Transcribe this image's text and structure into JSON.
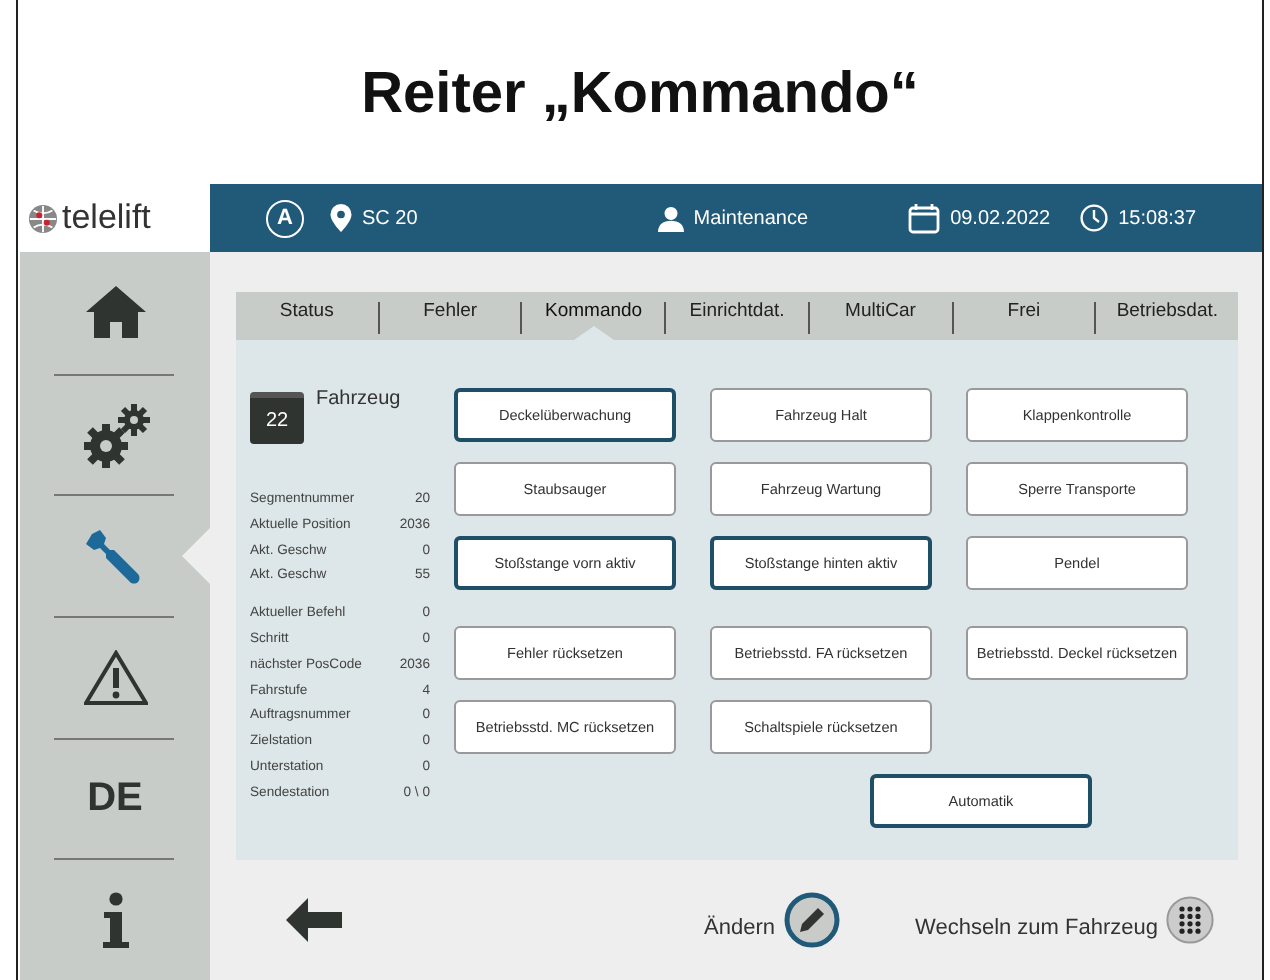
{
  "title": "Reiter „Kommando“",
  "header": {
    "logo": "telelift",
    "mode": "A",
    "station": "SC 20",
    "user": "Maintenance",
    "date": "09.02.2022",
    "time": "15:08:37"
  },
  "sidebar": {
    "items": [
      {
        "kind": "home",
        "selected": false
      },
      {
        "kind": "gears",
        "selected": false
      },
      {
        "kind": "wrench",
        "selected": true
      },
      {
        "kind": "warning",
        "selected": false
      },
      {
        "kind": "text",
        "label": "DE",
        "selected": false
      },
      {
        "kind": "info",
        "selected": false
      }
    ]
  },
  "tabs": [
    {
      "label": "Status",
      "selected": false
    },
    {
      "label": "Fehler",
      "selected": false
    },
    {
      "label": "Kommando",
      "selected": true
    },
    {
      "label": "Einrichtdat.",
      "selected": false
    },
    {
      "label": "MultiCar",
      "selected": false
    },
    {
      "label": "Frei",
      "selected": false
    },
    {
      "label": "Betriebsdat.",
      "selected": false
    }
  ],
  "vehicle": {
    "number": "22",
    "label": "Fahrzeug"
  },
  "stat_groups": [
    [
      {
        "name": "Segmentnummer",
        "value": "20"
      },
      {
        "name": "Aktuelle Position",
        "value": "2036"
      },
      {
        "name": "Akt. Geschw",
        "value": "0"
      },
      {
        "name": "Akt. Geschw",
        "value": "55"
      }
    ],
    [
      {
        "name": "Aktueller Befehl",
        "value": "0"
      },
      {
        "name": "Schritt",
        "value": "0"
      },
      {
        "name": "nächster PosCode",
        "value": "2036"
      },
      {
        "name": "Fahrstufe",
        "value": "4"
      },
      {
        "name": "Auftragsnummer",
        "value": "0"
      },
      {
        "name": "Zielstation",
        "value": "0"
      },
      {
        "name": "Unterstation",
        "value": "0"
      },
      {
        "name": "Sendestation",
        "value": "0 \\ 0"
      }
    ]
  ],
  "command_rows": [
    [
      {
        "label": "Deckelüberwachung",
        "active": true
      },
      {
        "label": "Fahrzeug Halt",
        "active": false
      },
      {
        "label": "Klappenkontrolle",
        "active": false
      }
    ],
    [
      {
        "label": "Staubsauger",
        "active": false
      },
      {
        "label": "Fahrzeug Wartung",
        "active": false
      },
      {
        "label": "Sperre Transporte",
        "active": false
      }
    ],
    [
      {
        "label": "Stoßstange vorn aktiv",
        "active": true
      },
      {
        "label": "Stoßstange hinten aktiv",
        "active": true
      },
      {
        "label": "Pendel",
        "active": false
      }
    ],
    [
      {
        "label": "Fehler rücksetzen",
        "active": false
      },
      {
        "label": "Betriebsstd. FA rücksetzen",
        "active": false
      },
      {
        "label": "Betriebsstd. Deckel rücksetzen",
        "active": false
      }
    ],
    [
      {
        "label": "Betriebsstd. MC rücksetzen",
        "active": false
      },
      {
        "label": "Schaltspiele rücksetzen",
        "active": false
      }
    ]
  ],
  "automatic_button": {
    "label": "Automatik",
    "active": true
  },
  "footer": {
    "edit_label": "Ändern",
    "switch_label": "Wechseln zum Fahrzeug"
  }
}
